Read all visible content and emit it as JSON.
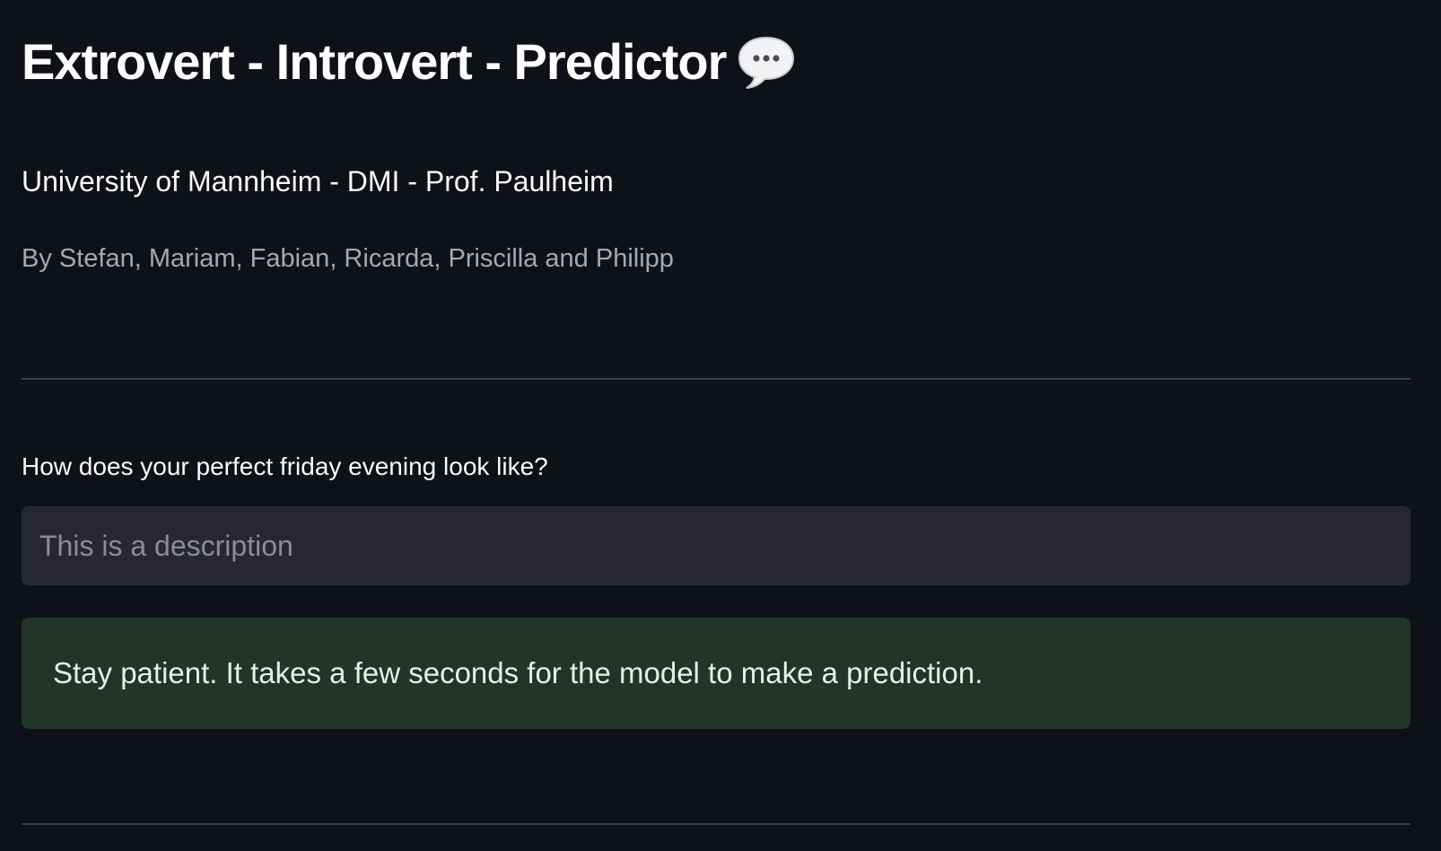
{
  "header": {
    "title": "Extrovert - Introvert - Predictor",
    "title_icon": "speech-bubble-icon",
    "subtitle": "University of Mannheim - DMI - Prof. Paulheim",
    "authors": "By Stefan, Mariam, Fabian, Ricarda, Priscilla and Philipp"
  },
  "form": {
    "question_label": "How does your perfect friday evening look like?",
    "input_value": "",
    "input_placeholder": "This is a description"
  },
  "status": {
    "info_message": "Stay patient. It takes a few seconds for the model to make a prediction."
  },
  "colors": {
    "background": "#0e1117",
    "input_background": "#262730",
    "info_background": "#233429",
    "info_text": "#dff5e4",
    "muted_text": "#a3a8b4",
    "divider": "#3b3d45"
  }
}
